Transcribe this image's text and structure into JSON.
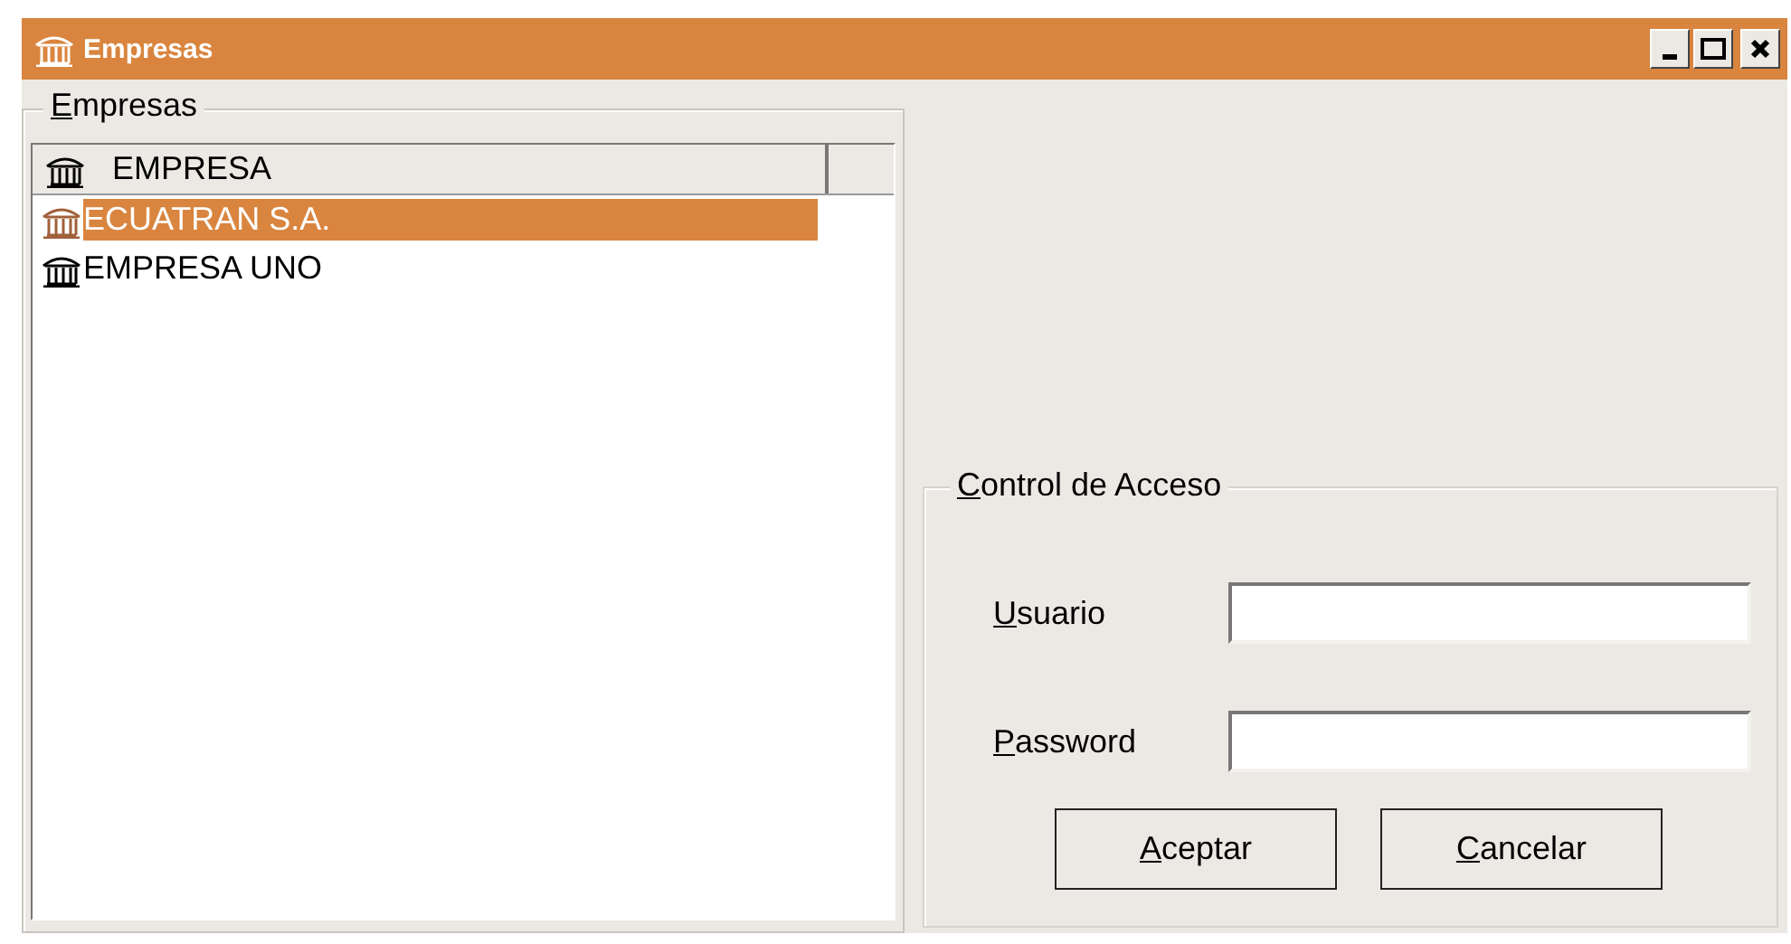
{
  "window": {
    "title": "Empresas"
  },
  "companies_group": {
    "legend": "Empresas",
    "column_header": "EMPRESA",
    "rows": [
      {
        "name": "ECUATRAN S.A.",
        "selected": true
      },
      {
        "name": "EMPRESA UNO",
        "selected": false
      }
    ]
  },
  "access_group": {
    "legend": "Control de Acceso",
    "fields": [
      {
        "label": "Usuario"
      },
      {
        "label": "Password"
      }
    ],
    "buttons": [
      "Aceptar",
      "Cancelar"
    ]
  }
}
